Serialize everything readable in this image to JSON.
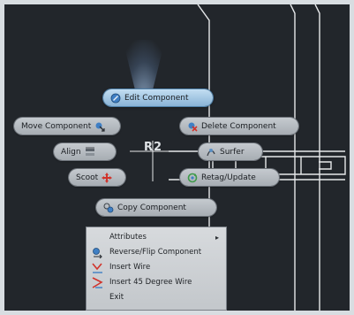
{
  "marking_menu": {
    "edit_component": "Edit Component",
    "move_component": "Move Component",
    "delete_component": "Delete Component",
    "align": "Align",
    "surfer": "Surfer",
    "scoot": "Scoot",
    "retag_update": "Retag/Update",
    "copy_component": "Copy Component"
  },
  "canvas": {
    "reference_designator": "R2"
  },
  "context_menu": {
    "items": [
      {
        "label": "Attributes",
        "has_submenu": true,
        "icon": ""
      },
      {
        "label": "Reverse/Flip Component",
        "has_submenu": false,
        "icon": "reverse-flip-icon"
      },
      {
        "label": "Insert Wire",
        "has_submenu": false,
        "icon": "insert-wire-icon"
      },
      {
        "label": "Insert 45 Degree Wire",
        "has_submenu": false,
        "icon": "insert-45-wire-icon"
      },
      {
        "label": "Exit",
        "has_submenu": false,
        "icon": ""
      }
    ],
    "submenu_arrow": "▸"
  },
  "colors": {
    "background": "#22262b",
    "wire": "#e6e8ea",
    "pill": "#b7bcc1",
    "pill_active": "#a9cbe6",
    "menu": "#cfd3d7",
    "delete_red": "#d1332b",
    "move_blue": "#3f7fc4"
  }
}
